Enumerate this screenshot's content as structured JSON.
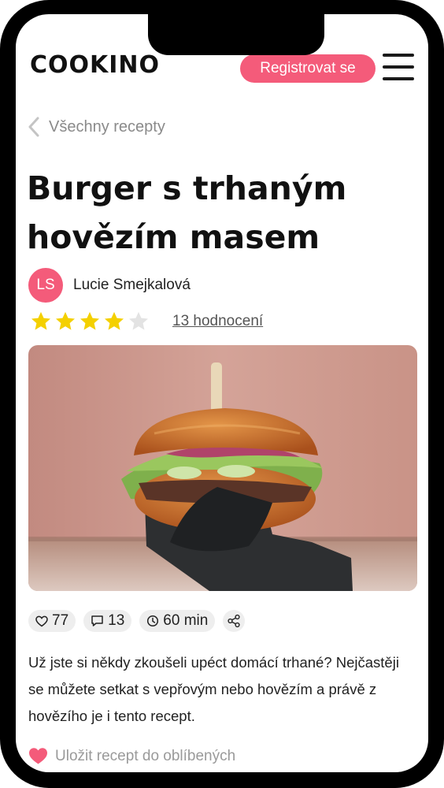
{
  "header": {
    "logo": "COOKINO",
    "register_label": "Registrovat se",
    "menu_icon": "hamburger-menu-icon"
  },
  "nav": {
    "back_label": "Všechny recepty",
    "back_icon": "chevron-left-icon"
  },
  "recipe": {
    "title": "Burger s trhaným hovězím masem",
    "author": {
      "initials": "LS",
      "name": "Lucie Smejkalová",
      "avatar_color": "#f45b7a"
    },
    "rating": {
      "stars": 4,
      "max": 5,
      "count_label": "13 hodnocení",
      "star_color": "#f4d000"
    },
    "image_icon": "burger-photo",
    "stats": {
      "likes": "77",
      "comments": "13",
      "time": "60 min"
    },
    "description": "Už jste si někdy zkoušeli upéct domácí trhané? Nejčastěji se můžete setkat s vepřovým nebo hovězím a právě z hovězího je i tento recept.",
    "save_label": "Uložit recept do oblíbených"
  },
  "colors": {
    "accent": "#f45b7a"
  }
}
